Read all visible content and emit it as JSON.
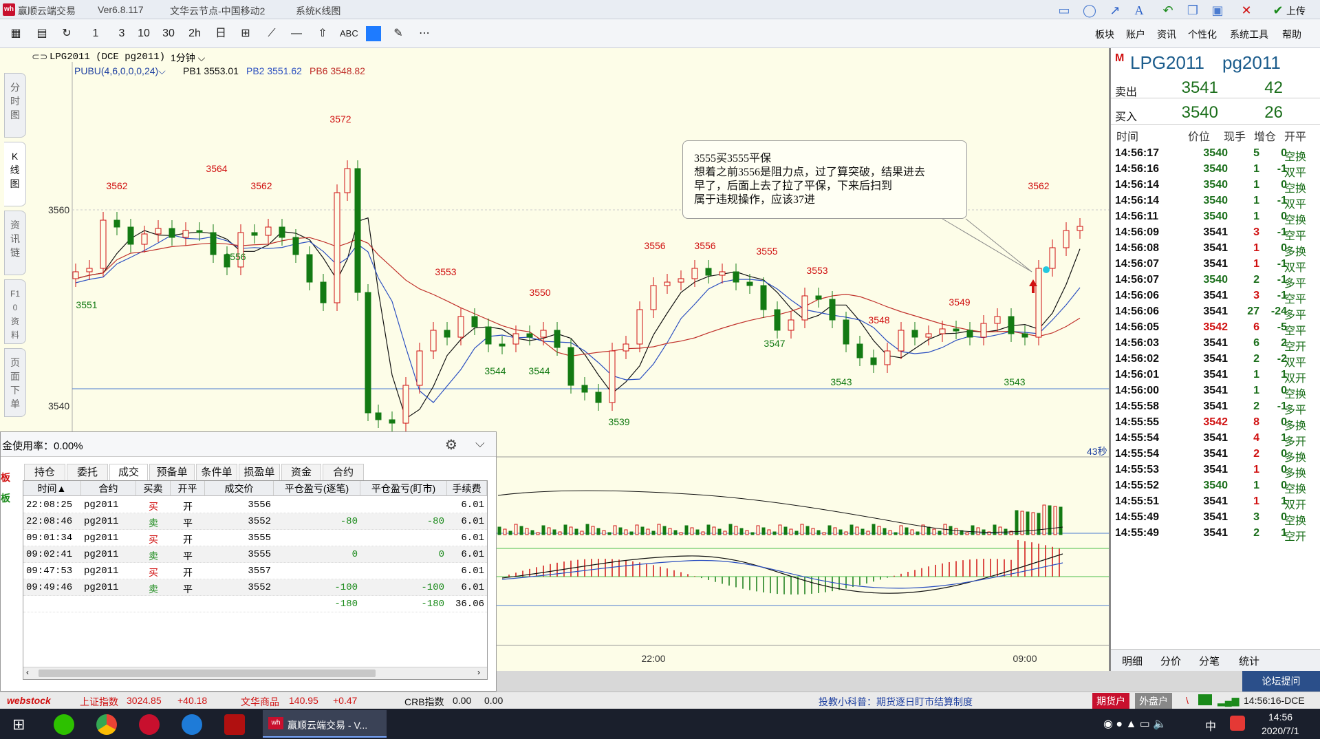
{
  "titlebar": {
    "app_name": "赢顺云端交易",
    "version": "Ver6.8.117",
    "node": "文华云节点-中国移动2",
    "view": "系统K线图",
    "upload": "上传"
  },
  "menu": [
    "板块",
    "账户",
    "资讯",
    "个性化",
    "系统工具",
    "帮助"
  ],
  "toolbar": {
    "abc_label": "ABC",
    "periods": [
      "1",
      "3",
      "10",
      "30",
      "2h",
      "日"
    ]
  },
  "left_tabs": [
    "分时图",
    "K线图",
    "资讯链",
    "F10资料",
    "页面下单"
  ],
  "chart": {
    "symbol_line": "LPG2011 (DCE pg2011)",
    "period": "1分钟",
    "indicator": "PUBU(4,6,0,0,0,24)",
    "pb1": "PB1 3553.01",
    "pb2": "PB2 3551.62",
    "pb6": "PB6 3548.82",
    "countdown": "43秒",
    "y_labels": [
      "3560",
      "3540"
    ],
    "x_labels": [
      "22:00",
      "09:00"
    ],
    "peaks_red": [
      {
        "label": "3562"
      },
      {
        "label": "3564"
      },
      {
        "label": "3562"
      },
      {
        "label": "3572"
      },
      {
        "label": "3553"
      },
      {
        "label": "3550"
      },
      {
        "label": "3556"
      },
      {
        "label": "3556"
      },
      {
        "label": "3555"
      },
      {
        "label": "3553"
      },
      {
        "label": "3548"
      },
      {
        "label": "3549"
      },
      {
        "label": "3562"
      }
    ],
    "troughs_green": [
      {
        "label": "3551"
      },
      {
        "label": "3556"
      },
      {
        "label": "3544"
      },
      {
        "label": "3544"
      },
      {
        "label": "3539"
      },
      {
        "label": "3547"
      },
      {
        "label": "3543"
      },
      {
        "label": "3543"
      }
    ],
    "annotation": {
      "line1": "3555买3555平保",
      "line2": "想着之前3556是阻力点，过了算突破，结果进去",
      "line3": "早了，后面上去了拉了平保，下来后扫到",
      "line4": "属于违规操作，应该37进"
    }
  },
  "quote": {
    "tag": "M",
    "name": "LPG2011",
    "code": "pg2011",
    "sell_label": "卖出",
    "sell_price": "3541",
    "sell_vol": "42",
    "buy_label": "买入",
    "buy_price": "3540",
    "buy_vol": "26",
    "headers": [
      "时间",
      "价位",
      "现手",
      "增仓",
      "开平"
    ],
    "ticks": [
      {
        "time": "14:56:17",
        "price": "3540",
        "qty": "5",
        "inc": "0",
        "type": "空换",
        "pc": "#1a6e1a",
        "qc": "#1a6e1a"
      },
      {
        "time": "14:56:16",
        "price": "3540",
        "qty": "1",
        "inc": "-1",
        "type": "双平",
        "pc": "#1a6e1a",
        "qc": "#1a6e1a"
      },
      {
        "time": "14:56:14",
        "price": "3540",
        "qty": "1",
        "inc": "0",
        "type": "空换",
        "pc": "#1a6e1a",
        "qc": "#1a6e1a"
      },
      {
        "time": "14:56:14",
        "price": "3540",
        "qty": "1",
        "inc": "-1",
        "type": "双平",
        "pc": "#1a6e1a",
        "qc": "#1a6e1a"
      },
      {
        "time": "14:56:11",
        "price": "3540",
        "qty": "1",
        "inc": "0",
        "type": "空换",
        "pc": "#1a6e1a",
        "qc": "#1a6e1a"
      },
      {
        "time": "14:56:09",
        "price": "3541",
        "qty": "3",
        "inc": "-1",
        "type": "空平",
        "pc": "#111111",
        "qc": "#d01010"
      },
      {
        "time": "14:56:08",
        "price": "3541",
        "qty": "1",
        "inc": "0",
        "type": "多换",
        "pc": "#111111",
        "qc": "#d01010"
      },
      {
        "time": "14:56:07",
        "price": "3541",
        "qty": "1",
        "inc": "-1",
        "type": "双平",
        "pc": "#111111",
        "qc": "#d01010"
      },
      {
        "time": "14:56:07",
        "price": "3540",
        "qty": "2",
        "inc": "-1",
        "type": "多平",
        "pc": "#1a6e1a",
        "qc": "#1a6e1a"
      },
      {
        "time": "14:56:06",
        "price": "3541",
        "qty": "3",
        "inc": "-1",
        "type": "空平",
        "pc": "#111111",
        "qc": "#d01010"
      },
      {
        "time": "14:56:06",
        "price": "3541",
        "qty": "27",
        "inc": "-24",
        "type": "多平",
        "pc": "#111111",
        "qc": "#1a6e1a"
      },
      {
        "time": "14:56:05",
        "price": "3542",
        "qty": "6",
        "inc": "-5",
        "type": "空平",
        "pc": "#d01010",
        "qc": "#d01010"
      },
      {
        "time": "14:56:03",
        "price": "3541",
        "qty": "6",
        "inc": "2",
        "type": "空开",
        "pc": "#111111",
        "qc": "#1a6e1a"
      },
      {
        "time": "14:56:02",
        "price": "3541",
        "qty": "2",
        "inc": "-2",
        "type": "双平",
        "pc": "#111111",
        "qc": "#1a6e1a"
      },
      {
        "time": "14:56:01",
        "price": "3541",
        "qty": "1",
        "inc": "1",
        "type": "双开",
        "pc": "#111111",
        "qc": "#1a6e1a"
      },
      {
        "time": "14:56:00",
        "price": "3541",
        "qty": "1",
        "inc": "0",
        "type": "空换",
        "pc": "#111111",
        "qc": "#1a6e1a"
      },
      {
        "time": "14:55:58",
        "price": "3541",
        "qty": "2",
        "inc": "-1",
        "type": "多平",
        "pc": "#111111",
        "qc": "#1a6e1a"
      },
      {
        "time": "14:55:55",
        "price": "3542",
        "qty": "8",
        "inc": "0",
        "type": "多换",
        "pc": "#d01010",
        "qc": "#d01010"
      },
      {
        "time": "14:55:54",
        "price": "3541",
        "qty": "4",
        "inc": "1",
        "type": "多开",
        "pc": "#111111",
        "qc": "#d01010"
      },
      {
        "time": "14:55:54",
        "price": "3541",
        "qty": "2",
        "inc": "0",
        "type": "多换",
        "pc": "#111111",
        "qc": "#d01010"
      },
      {
        "time": "14:55:53",
        "price": "3541",
        "qty": "1",
        "inc": "0",
        "type": "多换",
        "pc": "#111111",
        "qc": "#d01010"
      },
      {
        "time": "14:55:52",
        "price": "3540",
        "qty": "1",
        "inc": "0",
        "type": "空换",
        "pc": "#1a6e1a",
        "qc": "#1a6e1a"
      },
      {
        "time": "14:55:51",
        "price": "3541",
        "qty": "1",
        "inc": "1",
        "type": "双开",
        "pc": "#111111",
        "qc": "#d01010"
      },
      {
        "time": "14:55:49",
        "price": "3541",
        "qty": "3",
        "inc": "0",
        "type": "空换",
        "pc": "#111111",
        "qc": "#1a6e1a"
      },
      {
        "time": "14:55:49",
        "price": "3541",
        "qty": "2",
        "inc": "1",
        "type": "空开",
        "pc": "#111111",
        "qc": "#1a6e1a"
      }
    ],
    "bottom_tabs": [
      "明细",
      "分价",
      "分笔",
      "统计"
    ]
  },
  "trade": {
    "usage": "金使用率：0.00%",
    "side_labels": [
      "板",
      "板"
    ],
    "tabs": [
      "持仓",
      "委托",
      "成交",
      "预备单",
      "条件单",
      "损盈单",
      "资金",
      "合约"
    ],
    "active_tab": "成交",
    "columns": [
      "时间▲",
      "合约",
      "买卖",
      "开平",
      "成交价",
      "平仓盈亏(逐笔)",
      "平仓盈亏(盯市)",
      "手续费"
    ],
    "rows": [
      {
        "time": "22:08:25",
        "contract": "pg2011",
        "side": "买",
        "oc": "开",
        "price": "3556",
        "pnl1": "",
        "pnl2": "",
        "fee": "6.01",
        "sc": "#d01010"
      },
      {
        "time": "22:08:46",
        "contract": "pg2011",
        "side": "卖",
        "oc": "平",
        "price": "3552",
        "pnl1": "-80",
        "pnl2": "-80",
        "fee": "6.01",
        "sc": "#1a8a1a"
      },
      {
        "time": "09:01:34",
        "contract": "pg2011",
        "side": "买",
        "oc": "开",
        "price": "3555",
        "pnl1": "",
        "pnl2": "",
        "fee": "6.01",
        "sc": "#d01010"
      },
      {
        "time": "09:02:41",
        "contract": "pg2011",
        "side": "卖",
        "oc": "平",
        "price": "3555",
        "pnl1": "0",
        "pnl2": "0",
        "fee": "6.01",
        "sc": "#1a8a1a"
      },
      {
        "time": "09:47:53",
        "contract": "pg2011",
        "side": "买",
        "oc": "开",
        "price": "3557",
        "pnl1": "",
        "pnl2": "",
        "fee": "6.01",
        "sc": "#d01010"
      },
      {
        "time": "09:49:46",
        "contract": "pg2011",
        "side": "卖",
        "oc": "平",
        "price": "3552",
        "pnl1": "-100",
        "pnl2": "-100",
        "fee": "6.01",
        "sc": "#1a8a1a"
      }
    ],
    "totals": {
      "pnl1": "-180",
      "pnl2": "-180",
      "fee": "36.06"
    }
  },
  "statusbar": {
    "logo": "webstock",
    "index1": "上证指数",
    "index1_val": "3024.85",
    "index1_chg": "+40.18",
    "index2": "文华商品",
    "index2_val": "140.95",
    "index2_chg": "+0.47",
    "index3": "CRB指数",
    "index3_val": "0.00",
    "index3_chg": "0.00",
    "news": "投教小科普：期货逐日盯市结算制度",
    "futures_acct": "期货户",
    "foreign_acct": "外盘户",
    "clock": "14:56:16-DCE",
    "forum": "论坛提问"
  },
  "taskbar": {
    "app_label": "赢顺云端交易 - V...",
    "time": "14:56",
    "date": "2020/7/1",
    "ime": "中"
  },
  "colors": {
    "up": "#d01010",
    "down": "#137a13",
    "ma_red": "#c0302a",
    "ma_blue": "#2b4fc0",
    "ma_black": "#111111",
    "ref_line": "#4c7bd0"
  }
}
